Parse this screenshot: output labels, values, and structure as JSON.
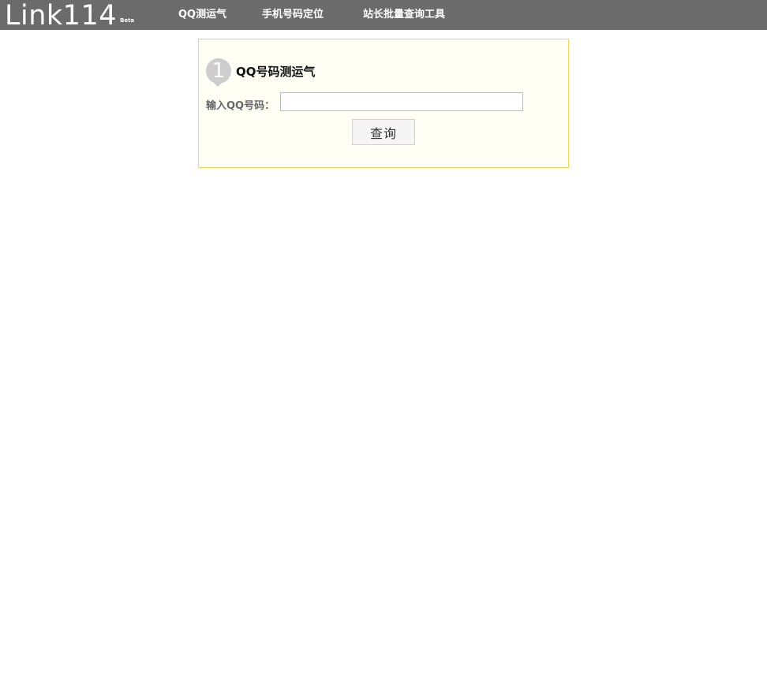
{
  "header": {
    "logo_text": "Link114",
    "beta_text": "Beta",
    "nav": [
      {
        "label": "QQ测运气"
      },
      {
        "label": "手机号码定位"
      },
      {
        "label": "站长批量查询工具"
      }
    ]
  },
  "panel": {
    "step_number": "1",
    "title": "QQ号码测运气",
    "field_label": "输入QQ号码：",
    "input_value": "",
    "input_placeholder": "",
    "button_label": "查询"
  },
  "colors": {
    "header_bg": "#6b6b6b",
    "panel_bg": "#fffff6",
    "panel_border": "#efd862",
    "badge_bg": "#cdcdcd"
  }
}
